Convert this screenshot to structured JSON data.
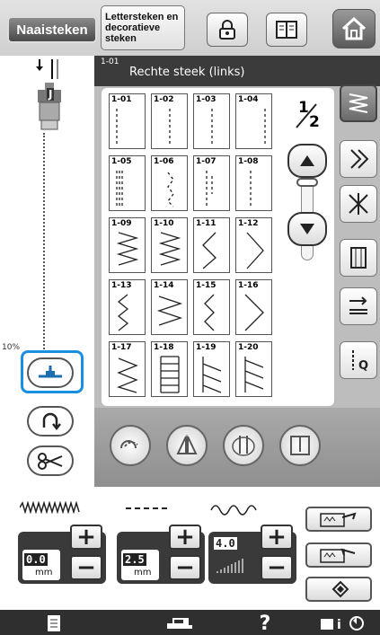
{
  "top_tabs": {
    "active": "Naaisteken",
    "inactive": "Lettersteken en\ndecoratieve\nsteken"
  },
  "top_icons": [
    "lock-icon",
    "book-icon",
    "home-icon"
  ],
  "left": {
    "presser_foot_label": "J",
    "width_readout": "10%"
  },
  "header": {
    "code": "1-01",
    "title": "Rechte steek (links)"
  },
  "stitches": [
    {
      "code": "1-01"
    },
    {
      "code": "1-02"
    },
    {
      "code": "1-03"
    },
    {
      "code": "1-04"
    },
    {
      "code": "1-05"
    },
    {
      "code": "1-06"
    },
    {
      "code": "1-07"
    },
    {
      "code": "1-08"
    },
    {
      "code": "1-09"
    },
    {
      "code": "1-10"
    },
    {
      "code": "1-11"
    },
    {
      "code": "1-12"
    },
    {
      "code": "1-13"
    },
    {
      "code": "1-14"
    },
    {
      "code": "1-15"
    },
    {
      "code": "1-16"
    },
    {
      "code": "1-17"
    },
    {
      "code": "1-18"
    },
    {
      "code": "1-19"
    },
    {
      "code": "1-20"
    }
  ],
  "page": {
    "numerator": "1",
    "denominator": "2"
  },
  "controls": {
    "width": {
      "value": "0.0",
      "unit": "mm"
    },
    "length": {
      "value": "2.5",
      "unit": "mm"
    },
    "tension": {
      "value": "4.0"
    }
  },
  "bottom_bar": {
    "help_label": "?"
  },
  "colors": {
    "highlight": "#1a8fe0",
    "header_bg": "#3b3b3b",
    "panel_bg": "#bdbdbd"
  }
}
